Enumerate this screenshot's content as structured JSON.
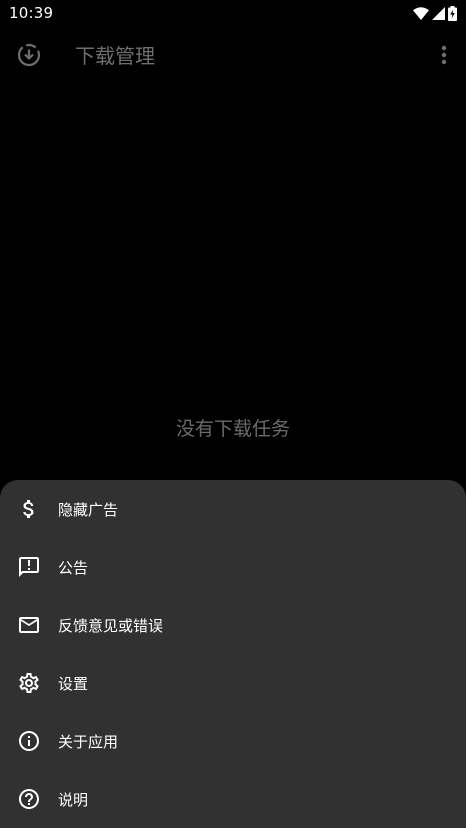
{
  "status_bar": {
    "time": "10:39",
    "icons": [
      "wifi-icon",
      "signal-icon",
      "battery-charging-icon"
    ]
  },
  "app_bar": {
    "icon": "download-icon",
    "title": "下载管理",
    "overflow_icon": "more-vert-icon"
  },
  "main": {
    "empty_text": "没有下载任务"
  },
  "menu": {
    "items": [
      {
        "label": "隐藏广告",
        "icon": "dollar-icon"
      },
      {
        "label": "公告",
        "icon": "announcement-icon"
      },
      {
        "label": "反馈意见或错误",
        "icon": "mail-icon"
      },
      {
        "label": "设置",
        "icon": "gear-icon"
      },
      {
        "label": "关于应用",
        "icon": "info-icon"
      },
      {
        "label": "说明",
        "icon": "help-icon"
      }
    ]
  },
  "colors": {
    "background": "#000000",
    "sheet": "#313131",
    "dim_text": "#6f6f6f"
  }
}
